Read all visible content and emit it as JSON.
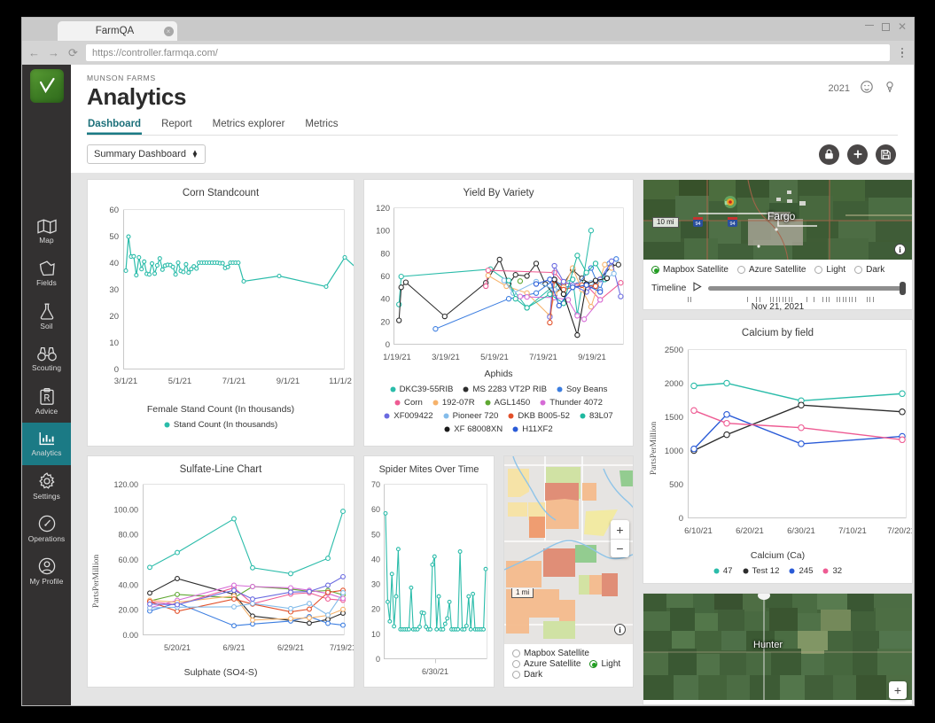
{
  "browser": {
    "tab_title": "FarmQA",
    "url": "https://controller.farmqa.com/",
    "back_icon": "←",
    "forward_icon": "→",
    "reload_icon": "⟳",
    "close_icon": "×",
    "menu_icon": "kebab-menu"
  },
  "header": {
    "org": "MUNSON FARMS",
    "title": "Analytics",
    "year": "2021",
    "emoji_icon": "☺",
    "help_icon": "?"
  },
  "tabs": [
    {
      "label": "Dashboard",
      "selected": true
    },
    {
      "label": "Report",
      "selected": false
    },
    {
      "label": "Metrics explorer",
      "selected": false
    },
    {
      "label": "Metrics",
      "selected": false
    }
  ],
  "sidebar": {
    "items": [
      {
        "label": "Map",
        "icon": "map-icon",
        "active": false
      },
      {
        "label": "Fields",
        "icon": "field-polygon-icon",
        "active": false
      },
      {
        "label": "Soil",
        "icon": "flask-icon",
        "active": false
      },
      {
        "label": "Scouting",
        "icon": "binoculars-icon",
        "active": false
      },
      {
        "label": "Advice",
        "icon": "prescription-clipboard-icon",
        "active": false
      },
      {
        "label": "Analytics",
        "icon": "bar-chart-icon",
        "active": true
      },
      {
        "label": "Settings",
        "icon": "gear-icon",
        "active": false
      },
      {
        "label": "Operations",
        "icon": "gauge-icon",
        "active": false
      },
      {
        "label": "My Profile",
        "icon": "user-circle-icon",
        "active": false
      }
    ]
  },
  "toolbar": {
    "dashboard_select": "Summary Dashboard",
    "lock_label": "lock-icon",
    "add_label": "plus-icon",
    "save_label": "save-icon"
  },
  "colors": {
    "accent_teal": "#1b7a85",
    "series_teal": "#2bbcaa",
    "panel_bg": "#e4e4e4"
  },
  "chart_data": [
    {
      "type": "line",
      "title": "Corn Standcount",
      "xlabel": "Female Stand Count (In thousands)",
      "ylabel": "",
      "ylim": [
        0,
        60
      ],
      "yticks": [
        0,
        10,
        20,
        30,
        40,
        50,
        60
      ],
      "xticks": [
        "3/1/21",
        "5/1/21",
        "7/1/21",
        "9/1/21",
        "11/1/21"
      ],
      "grid": false,
      "legend": [
        {
          "name": "Stand Count (In thousands)",
          "color": "#2bbcaa"
        }
      ],
      "series": [
        {
          "name": "Stand Count (In thousands)",
          "color": "#2bbcaa",
          "values": [
            37,
            49.8,
            42.3,
            42.4,
            35.3,
            42,
            37.6,
            40.4,
            35.8,
            35.6,
            39.7,
            35.9,
            39,
            41.6,
            37.4,
            38.9,
            39.2,
            39.1,
            38.4,
            35.6,
            40,
            36.9,
            36.5,
            39.4,
            36.3,
            37.6,
            38.6,
            37.8,
            40,
            40,
            40,
            40,
            40,
            40,
            40,
            40,
            39.8,
            39.8,
            38,
            38.4,
            40,
            40,
            40,
            40,
            33,
            35,
            31,
            42,
            38
          ]
        }
      ]
    },
    {
      "type": "line",
      "title": "Yield By Variety",
      "subtitle": "Aphids",
      "xlabel": "Aphids",
      "ylim": [
        0,
        120
      ],
      "yticks": [
        0,
        20,
        40,
        60,
        80,
        100,
        120
      ],
      "xticks": [
        "1/19/21",
        "3/19/21",
        "5/19/21",
        "7/19/21",
        "9/19/21"
      ],
      "legend": [
        {
          "name": "DKC39-55RIB",
          "color": "#2bbcaa"
        },
        {
          "name": "MS 2283 VT2P RIB",
          "color": "#2d2d2d"
        },
        {
          "name": "Soy Beans",
          "color": "#3b7de0"
        },
        {
          "name": "Corn",
          "color": "#ee5b93"
        },
        {
          "name": "192-07R",
          "color": "#f6b26b"
        },
        {
          "name": "AGL1450",
          "color": "#5fa832"
        },
        {
          "name": "Thunder 4072",
          "color": "#d66bd6"
        },
        {
          "name": "XF009422",
          "color": "#6a6ae0"
        },
        {
          "name": "Pioneer 720",
          "color": "#84bcea"
        },
        {
          "name": "DKB B005-52",
          "color": "#e2502a"
        },
        {
          "name": "83L07",
          "color": "#1fb9a0"
        },
        {
          "name": "XF 68008XN",
          "color": "#1a1a1a"
        },
        {
          "name": "H11XF2",
          "color": "#2a5bd7"
        }
      ]
    },
    {
      "type": "line",
      "title": "Calcium by field",
      "xlabel": "Calcium (Ca)",
      "ylabel": "PartsPerMillion",
      "ylim": [
        0,
        2500
      ],
      "yticks": [
        0,
        500,
        1000,
        1500,
        2000,
        2500
      ],
      "xticks": [
        "6/10/21",
        "6/20/21",
        "6/30/21",
        "7/10/21",
        "7/20/21"
      ],
      "legend": [
        {
          "name": "47",
          "color": "#2bbcaa"
        },
        {
          "name": "Test 12",
          "color": "#2d2d2d"
        },
        {
          "name": "245",
          "color": "#2a5bd7"
        },
        {
          "name": "32",
          "color": "#ee5b93"
        }
      ],
      "series": [
        {
          "name": "47",
          "color": "#2bbcaa",
          "x": [
            "6/10/21",
            "6/16/21",
            "6/30/21",
            "7/21/21"
          ],
          "values": [
            1960,
            2000,
            1740,
            1845
          ]
        },
        {
          "name": "Test 12",
          "color": "#2d2d2d",
          "x": [
            "6/10/21",
            "6/16/21",
            "6/30/21",
            "7/21/21"
          ],
          "values": [
            1000,
            1235,
            1675,
            1575
          ]
        },
        {
          "name": "245",
          "color": "#2a5bd7",
          "x": [
            "6/10/21",
            "6/16/21",
            "6/30/21",
            "7/21/21"
          ],
          "values": [
            1025,
            1535,
            1100,
            1210
          ]
        },
        {
          "name": "32",
          "color": "#ee5b93",
          "x": [
            "6/10/21",
            "6/16/21",
            "6/30/21",
            "7/21/21"
          ],
          "values": [
            1595,
            1405,
            1340,
            1160
          ]
        }
      ]
    },
    {
      "type": "line",
      "title": "Sulfate-Line Chart",
      "xlabel": "Sulphate (SO4-S)",
      "ylabel": "PartsPerMillion",
      "ylim": [
        0,
        120
      ],
      "yticks": [
        "0.00",
        "20.00",
        "40.00",
        "60.00",
        "80.00",
        "100.00",
        "120.00"
      ],
      "xticks": [
        "5/20/21",
        "6/9/21",
        "6/29/21",
        "7/19/21"
      ],
      "series": [
        {
          "name": "series-teal",
          "color": "#2bbcaa",
          "values": [
            53.8,
            65.6,
            92.5,
            53.4,
            48.8,
            61.0,
            98.4
          ]
        },
        {
          "name": "series-black",
          "color": "#2d2d2d",
          "values": [
            33.3,
            44.8,
            32.2,
            15.0,
            11.5,
            9.3,
            12.3,
            17.3
          ]
        },
        {
          "name": "series-blue",
          "color": "#3b7de0",
          "values": [
            19.0,
            25.5,
            7.3,
            8.6,
            11.0,
            14.5,
            9.2,
            7.7
          ]
        },
        {
          "name": "series-green",
          "color": "#5fa832",
          "values": [
            27.0,
            32.2,
            29.5,
            38.5,
            36.5,
            34.5,
            35.3,
            31.8
          ]
        },
        {
          "name": "series-pink",
          "color": "#ee5b93",
          "values": [
            26.5,
            24.0,
            37.5,
            24.8,
            32.5,
            33.5,
            28.5,
            27.5
          ]
        },
        {
          "name": "series-magenta",
          "color": "#d66bd6",
          "values": [
            21.5,
            27.5,
            39.5,
            38.5,
            37.5,
            35.5,
            33.0,
            29.0
          ]
        },
        {
          "name": "series-orange",
          "color": "#f6b26b",
          "values": [
            27.5,
            26.0,
            31.0,
            11.8,
            13.0,
            13.5,
            15.5,
            20.3
          ]
        },
        {
          "name": "series-red",
          "color": "#e2502a",
          "values": [
            26.5,
            18.8,
            28.5,
            24.5,
            18.3,
            20.5,
            33.8,
            35.5
          ]
        },
        {
          "name": "series-lightblue",
          "color": "#84bcea",
          "values": [
            21.5,
            22.0,
            22.3,
            25.0,
            21.0,
            25.0,
            15.8,
            33.5
          ]
        },
        {
          "name": "series-purple",
          "color": "#6a6ae0",
          "values": [
            24.5,
            24.0,
            35.5,
            28.5,
            34.0,
            34.5,
            39.5,
            46.3
          ]
        }
      ]
    },
    {
      "type": "line",
      "title": "Spider Mites Over Time",
      "xlabel": "",
      "ylim": [
        0,
        70
      ],
      "yticks": [
        0,
        10,
        20,
        30,
        40,
        50,
        60,
        70
      ],
      "xticks": [
        "6/30/21"
      ],
      "series": [
        {
          "name": "Spider Mites",
          "color": "#2bbcaa",
          "values": [
            58.3,
            22.8,
            15.0,
            34.0,
            13.0,
            25.0,
            44.0,
            11.8,
            11.8,
            11.8,
            11.8,
            11.8,
            28.5,
            11.8,
            11.8,
            11.8,
            12.8,
            18.5,
            18.3,
            12.8,
            11.8,
            11.8,
            37.7,
            41.0,
            11.8,
            25.0,
            11.8,
            11.8,
            14.0,
            16.2,
            22.8,
            11.8,
            11.8,
            11.8,
            11.8,
            43.0,
            11.8,
            11.8,
            13.2,
            25.0,
            11.8,
            26.0,
            11.8,
            11.8,
            11.8,
            11.8,
            11.8,
            36.0
          ]
        }
      ]
    }
  ],
  "map_top": {
    "place_label": "Fargo",
    "scale": "10 mi",
    "basemaps": [
      {
        "label": "Mapbox Satellite",
        "selected": true
      },
      {
        "label": "Azure Satellite",
        "selected": false
      },
      {
        "label": "Light",
        "selected": false
      },
      {
        "label": "Dark",
        "selected": false
      }
    ],
    "timeline_label": "Timeline",
    "play_icon": "play-icon",
    "timeline_date": "Nov 21, 2021",
    "info_icon": "info-icon"
  },
  "map_field": {
    "scale": "1 mi",
    "zoom_in": "+",
    "zoom_out": "−",
    "info_icon": "info-icon",
    "basemaps": [
      {
        "label": "Mapbox Satellite",
        "selected": false
      },
      {
        "label": "Azure Satellite",
        "selected": false
      },
      {
        "label": "Light",
        "selected": true
      },
      {
        "label": "Dark",
        "selected": false
      }
    ]
  },
  "map_bottom": {
    "place_label": "Hunter",
    "zoom_in": "+"
  }
}
